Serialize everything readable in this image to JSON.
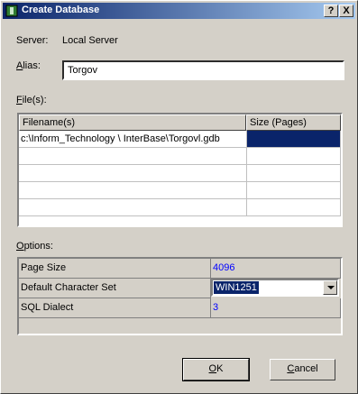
{
  "window": {
    "title": "Create Database",
    "help_label": "?",
    "close_label": "X"
  },
  "server": {
    "label": "Server:",
    "value": "Local Server"
  },
  "alias": {
    "label_underlined": "A",
    "label_rest": "lias:",
    "value": "Torgov"
  },
  "files": {
    "label_underlined": "F",
    "label_rest": "ile(s):",
    "columns": [
      "Filename(s)",
      "Size (Pages)"
    ],
    "rows": [
      {
        "filename": "c:\\Inform_Technology \\ InterBase\\Torgovl.gdb",
        "size": ""
      }
    ]
  },
  "options": {
    "label_underlined": "O",
    "label_rest": "ptions:",
    "rows": [
      {
        "name": "Page Size",
        "value": "4096"
      },
      {
        "name": "Default Character Set",
        "value": "WIN1251"
      },
      {
        "name": "SQL Dialect",
        "value": "3"
      }
    ]
  },
  "buttons": {
    "ok_underlined": "O",
    "ok_rest": "K",
    "cancel_underlined": "C",
    "cancel_rest": "ancel"
  },
  "colors": {
    "title_start": "#0a246a",
    "title_end": "#a6caf0",
    "value_text": "#0000ff",
    "selection": "#0a246a"
  }
}
